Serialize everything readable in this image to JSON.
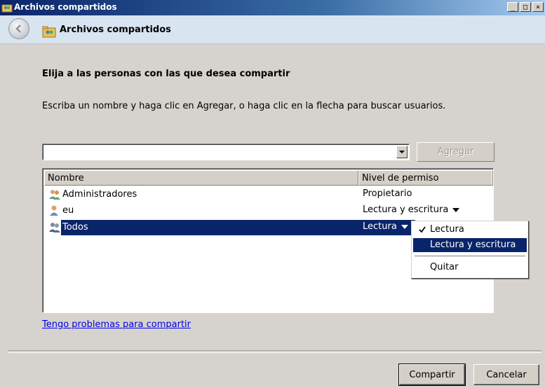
{
  "window": {
    "title": "Archivos compartidos"
  },
  "window_buttons": [
    "_",
    "□",
    "×"
  ],
  "nav": {
    "title": "Archivos compartidos"
  },
  "heading": "Elija a las personas con las que desea compartir",
  "instructions": "Escriba un nombre y haga clic en Agregar, o haga clic en la flecha para buscar usuarios.",
  "name_input": {
    "value": "",
    "placeholder": ""
  },
  "add_button": "Agregar",
  "table": {
    "headers": {
      "name": "Nombre",
      "permission": "Nivel de permiso"
    },
    "rows": [
      {
        "name": "Administradores",
        "permission": "Propietario",
        "icon": "group-icon",
        "dropdown": false
      },
      {
        "name": "eu",
        "permission": "Lectura y escritura",
        "icon": "user-icon",
        "dropdown": true
      },
      {
        "name": "Todos",
        "permission": "Lectura",
        "icon": "group-icon",
        "dropdown": true,
        "selected": true
      }
    ]
  },
  "permission_menu": {
    "items": [
      {
        "label": "Lectura",
        "checked": true
      },
      {
        "label": "Lectura y escritura",
        "highlighted": true
      },
      {
        "label": "Quitar"
      }
    ]
  },
  "help_link": "Tengo problemas para compartir",
  "buttons": {
    "share": "Compartir",
    "cancel": "Cancelar"
  },
  "colors": {
    "selection": "#0a246a",
    "titlebar": "#0a246a",
    "link": "#0000ee",
    "dialog_bg": "#d6d3ce"
  }
}
